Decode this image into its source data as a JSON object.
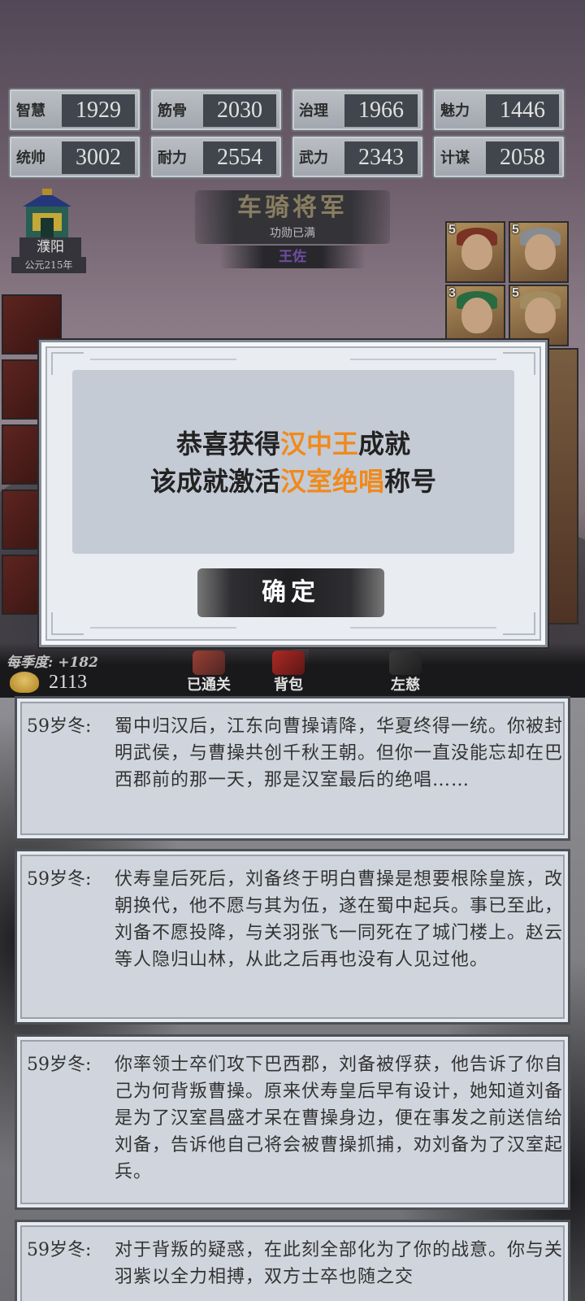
{
  "stats": [
    {
      "label": "智慧",
      "value": "1929"
    },
    {
      "label": "筋骨",
      "value": "2030"
    },
    {
      "label": "治理",
      "value": "1966"
    },
    {
      "label": "魅力",
      "value": "1446"
    },
    {
      "label": "统帅",
      "value": "3002"
    },
    {
      "label": "耐力",
      "value": "2554"
    },
    {
      "label": "武力",
      "value": "2343"
    },
    {
      "label": "计谋",
      "value": "2058"
    }
  ],
  "banner": {
    "title": "车骑将军",
    "subtitle": "功勋已满",
    "name": "王佐"
  },
  "location": {
    "name": "濮阳",
    "year": "公元215年"
  },
  "heroes": [
    {
      "level": "5"
    },
    {
      "level": "5"
    },
    {
      "level": "3"
    },
    {
      "level": "5"
    }
  ],
  "bottom": {
    "season_income": "每季度: +182",
    "gold": "2113",
    "nav": [
      "已通关",
      "背包",
      "左慈"
    ]
  },
  "modal": {
    "line1_prefix": "恭喜获得",
    "line1_highlight": "汉中王",
    "line1_suffix": "成就",
    "line2_prefix": "该成就激活",
    "line2_highlight": "汉室绝唱",
    "line2_suffix": "称号",
    "confirm": "确定",
    "highlight_color": "#f08a1c"
  },
  "logs": [
    {
      "age": "59岁冬:",
      "text": "蜀中归汉后，江东向曹操请降，华夏终得一统。你被封明武侯，与曹操共创千秋王朝。但你一直没能忘却在巴西郡前的那一天，那是汉室最后的绝唱……"
    },
    {
      "age": "59岁冬:",
      "text": "伏寿皇后死后，刘备终于明白曹操是想要根除皇族，改朝换代，他不愿与其为伍，遂在蜀中起兵。事已至此，刘备不愿投降，与关羽张飞一同死在了城门楼上。赵云等人隐归山林，从此之后再也没有人见过他。"
    },
    {
      "age": "59岁冬:",
      "text": "你率领士卒们攻下巴西郡，刘备被俘获，他告诉了你自己为何背叛曹操。原来伏寿皇后早有设计，她知道刘备是为了汉室昌盛才呆在曹操身边，便在事发之前送信给刘备，告诉他自己将会被曹操抓捕，劝刘备为了汉室起兵。"
    },
    {
      "age": "59岁冬:",
      "text": "对于背叛的疑惑，在此刻全部化为了你的战意。你与关羽紫以全力相搏，双方士卒也随之交"
    }
  ]
}
